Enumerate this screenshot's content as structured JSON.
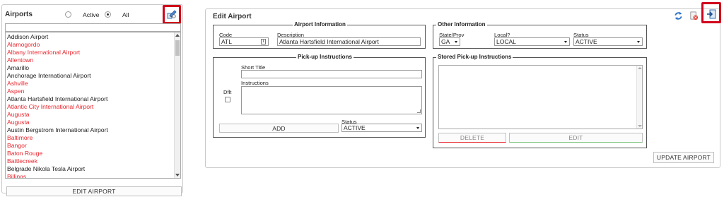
{
  "airports_panel": {
    "title": "Airports",
    "filter_active_label": "Active",
    "filter_all_label": "All",
    "filter_selected": "All",
    "search_value": "",
    "edit_button_label": "EDIT AIRPORT",
    "refresh_icon": "edit-list-icon",
    "list": [
      {
        "name": "Addison Airport",
        "active": true
      },
      {
        "name": "Alamogordo",
        "active": false
      },
      {
        "name": "Albany International Airport",
        "active": false
      },
      {
        "name": "Allentown",
        "active": false
      },
      {
        "name": "Amarillo",
        "active": true
      },
      {
        "name": "Anchorage International Airport",
        "active": true
      },
      {
        "name": "Ashville",
        "active": false
      },
      {
        "name": "Aspen",
        "active": false
      },
      {
        "name": "Atlanta Hartsfield International Airport",
        "active": true
      },
      {
        "name": "Atlantic City International Airport",
        "active": false
      },
      {
        "name": "Augusta",
        "active": false
      },
      {
        "name": "Augusta",
        "active": false
      },
      {
        "name": "Austin Bergstrom International Airport",
        "active": true
      },
      {
        "name": "Baltimore",
        "active": false
      },
      {
        "name": "Bangor",
        "active": false
      },
      {
        "name": "Baton Rouge",
        "active": false
      },
      {
        "name": "Battlecreek",
        "active": false
      },
      {
        "name": "Belgrade Nikola Tesla Airport",
        "active": true
      },
      {
        "name": "Billings",
        "active": false
      }
    ]
  },
  "edit_panel": {
    "title": "Edit Airport",
    "icons": [
      "refresh-icon",
      "cancel-icon",
      "exit-icon"
    ],
    "airport_info": {
      "title": "Airport Information",
      "code_label": "Code",
      "code_value": "ATL",
      "description_label": "Description",
      "description_value": "Atlanta Hartsfield International Airport"
    },
    "other_info": {
      "title": "Other Information",
      "state_label": "State/Prov",
      "state_value": "GA",
      "local_label": "Local?",
      "local_value": "LOCAL",
      "status_label": "Status",
      "status_value": "ACTIVE"
    },
    "pickup": {
      "title": "Pick-up Instructions",
      "short_title_label": "Short Title",
      "short_title_value": "",
      "dflt_label": "Dflt",
      "instructions_label": "Instructions",
      "instructions_value": "",
      "status_label": "Status",
      "status_value": "ACTIVE",
      "add_label": "ADD"
    },
    "stored_pickup": {
      "title": "Stored Pick-up Instructions",
      "delete_label": "DELETE",
      "edit_label": "EDIT"
    },
    "update_label": "UPDATE AIRPORT"
  },
  "colors": {
    "inactive_text": "#e8262e",
    "highlight": "#d0021b",
    "delete_accent": "#e8262e",
    "edit_accent": "#7cc27a"
  }
}
